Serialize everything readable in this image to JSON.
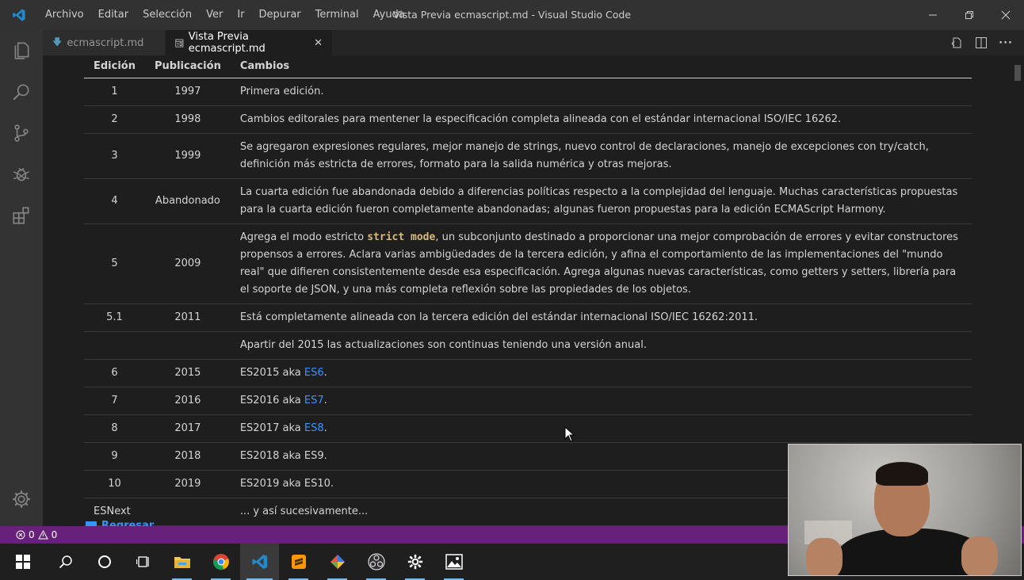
{
  "titlebar": {
    "menu": [
      "Archivo",
      "Editar",
      "Selección",
      "Ver",
      "Ir",
      "Depurar",
      "Terminal",
      "Ayuda"
    ],
    "title": "Vista Previa ecmascript.md - Visual Studio Code"
  },
  "tabs": [
    {
      "label": "ecmascript.md",
      "icon": "markdown-icon"
    },
    {
      "label": "Vista Previa ecmascript.md",
      "icon": "preview-icon"
    }
  ],
  "table": {
    "headers": [
      "Edición",
      "Publicación",
      "Cambios"
    ],
    "rows": [
      {
        "edition": "1",
        "year": "1997",
        "changes": "Primera edición."
      },
      {
        "edition": "2",
        "year": "1998",
        "changes": "Cambios editorales para mentener la especificación completa alineada con el estándar internacional ISO/IEC 16262."
      },
      {
        "edition": "3",
        "year": "1999",
        "changes": "Se agregaron expresiones regulares, mejor manejo de strings, nuevo control de declaraciones, manejo de excepciones con try/catch, definición más estricta de errores, formato para la salida numérica y otras mejoras."
      },
      {
        "edition": "4",
        "year": "Abandonado",
        "changes": "La cuarta edición fue abandonada debido a diferencias políticas respecto a la complejidad del lenguaje. Muchas características propuestas para la cuarta edición fueron completamente abandonadas; algunas fueron propuestas para la edición ECMAScript Harmony."
      },
      {
        "edition": "5",
        "year": "2009",
        "changes_pre": "Agrega el modo estricto ",
        "changes_code": "strict mode",
        "changes_post": ", un subconjunto destinado a proporcionar una mejor comprobación de errores y evitar constructores propensos a errores. Aclara varias ambigüedades de la tercera edición, y afina el comportamiento de las implementaciones del \"mundo real\" que difieren consistentemente desde esa especificación. Agrega algunas nuevas características, como getters y setters, librería para el soporte de JSON, y una más completa reflexión sobre las propiedades de los objetos."
      },
      {
        "edition": "5.1",
        "year": "2011",
        "changes": "Está completamente alineada con la tercera edición del estándar internacional ISO/IEC 16262:2011."
      },
      {
        "edition": "",
        "year": "",
        "changes": "Apartir del 2015 las actualizaciones son continuas teniendo una versión anual."
      },
      {
        "edition": "6",
        "year": "2015",
        "changes_pre": "ES2015 aka ",
        "link": "ES6",
        "changes_post": "."
      },
      {
        "edition": "7",
        "year": "2016",
        "changes_pre": "ES2016 aka ",
        "link": "ES7",
        "changes_post": "."
      },
      {
        "edition": "8",
        "year": "2017",
        "changes_pre": "ES2017 aka ",
        "link": "ES8",
        "changes_post": "."
      },
      {
        "edition": "9",
        "year": "2018",
        "changes": "ES2018 aka ES9."
      },
      {
        "edition": "10",
        "year": "2019",
        "changes": "ES2019 aka ES10."
      },
      {
        "edition": "ESNext",
        "year": "",
        "changes": "... y así sucesivamente..."
      }
    ]
  },
  "back_link": "Regresar",
  "status": {
    "errors": "0",
    "warnings": "0"
  },
  "colors": {
    "statusbar": "#68217a",
    "link": "#3794ff",
    "code": "#d7ba7d"
  }
}
